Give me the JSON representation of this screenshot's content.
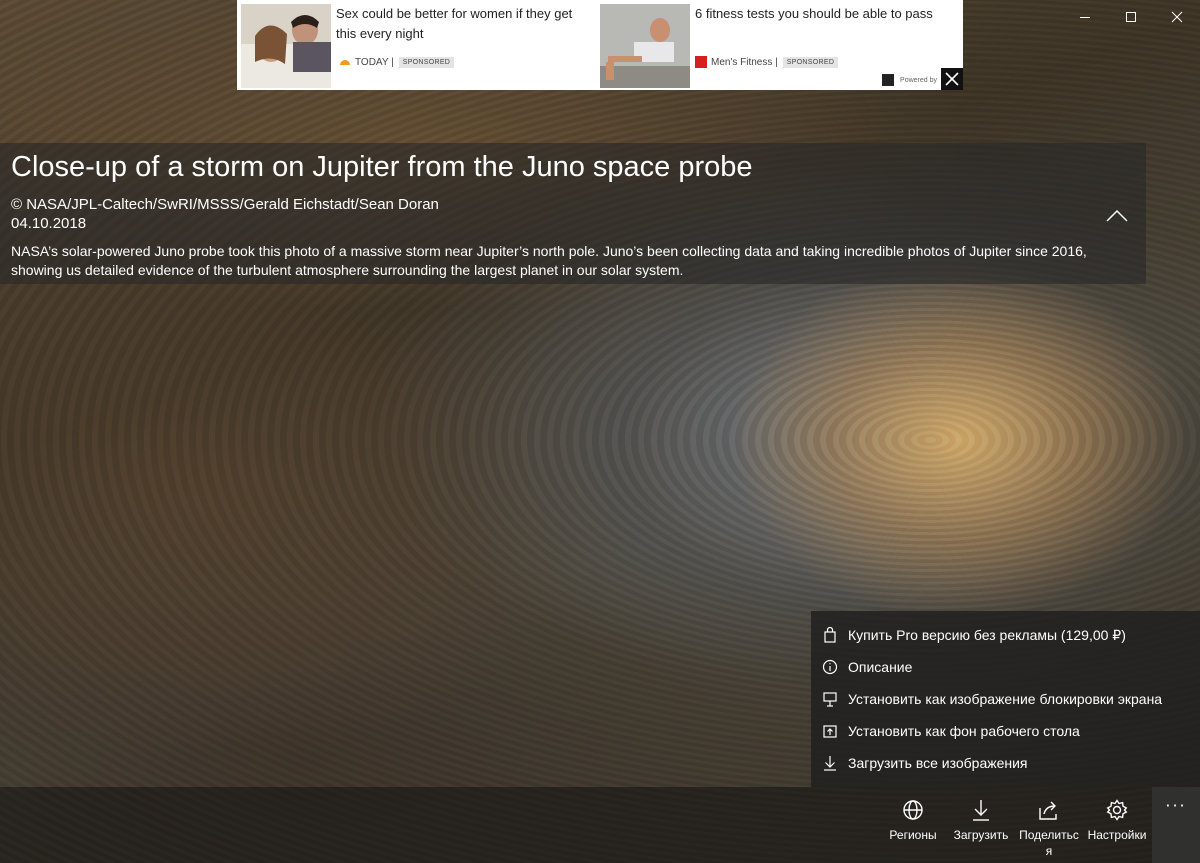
{
  "window": {
    "controls": {
      "minimize_icon": "minimize-icon",
      "maximize_icon": "maximize-icon",
      "close_icon": "close-icon"
    }
  },
  "ad": {
    "items": [
      {
        "title": "Sex could be better for women if they get this every night",
        "source": "TODAY |",
        "badge": "SPONSORED",
        "logo_color": "#f29a1b"
      },
      {
        "title": "6 fitness tests you should be able to pass",
        "source": "Men's Fitness |",
        "badge": "SPONSORED",
        "logo_color": "#d62020"
      }
    ],
    "powered_by": "Powered by"
  },
  "info": {
    "title": "Close-up of a storm on Jupiter from the Juno space probe",
    "copyright": "© NASA/JPL-Caltech/SwRI/MSSS/Gerald Eichstadt/Sean Doran",
    "date": "04.10.2018",
    "description": "NASA’s solar-powered Juno probe took this photo of a massive storm near Jupiter’s north pole. Juno’s been collecting data and taking incredible photos of Jupiter since 2016, showing us detailed evidence of the turbulent atmosphere surrounding the largest planet in our solar system."
  },
  "menu": {
    "items": [
      {
        "label": "Купить Pro версию без рекламы (129,00 ₽)",
        "icon": "shopping-bag-icon"
      },
      {
        "label": "Описание",
        "icon": "info-icon"
      },
      {
        "label": "Установить как изображение блокировки экрана",
        "icon": "lock-screen-icon"
      },
      {
        "label": "Установить как фон рабочего стола",
        "icon": "desktop-background-icon"
      },
      {
        "label": "Загрузить все изображения",
        "icon": "download-icon"
      }
    ]
  },
  "commands": {
    "items": [
      {
        "label": "Регионы",
        "icon": "globe-icon"
      },
      {
        "label": "Загрузить",
        "icon": "download-icon"
      },
      {
        "label": "Поделиться",
        "icon": "share-icon"
      },
      {
        "label": "Настройки",
        "icon": "gear-icon"
      }
    ],
    "more": "···"
  }
}
